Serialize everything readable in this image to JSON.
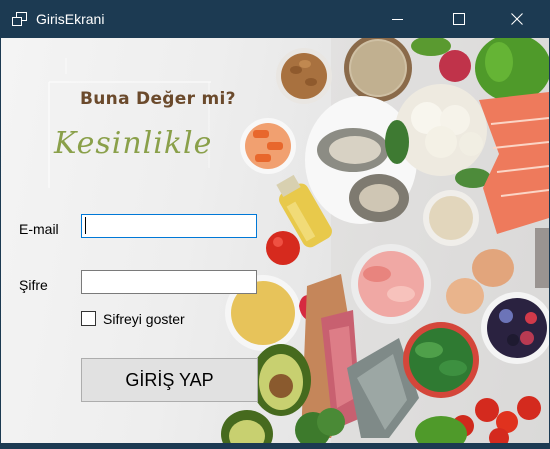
{
  "window": {
    "title": "GirisEkrani",
    "icon": "window-app-icon",
    "controls": [
      "minimize-icon",
      "maximize-icon",
      "close-icon"
    ]
  },
  "brand": {
    "tagline": "Buna Değer mi?",
    "script": "Kesinlikle"
  },
  "form": {
    "email_label": "E-mail",
    "email_value": "",
    "password_label": "Şifre",
    "password_value": "",
    "show_password_label": "Sifreyi goster",
    "show_password_checked": false,
    "submit_label": "GİRİŞ YAP"
  },
  "colors": {
    "titlebar": "#1c3a52",
    "focus_border": "#0078d7",
    "tagline": "#6b4a2c",
    "script": "#8aa04a"
  }
}
